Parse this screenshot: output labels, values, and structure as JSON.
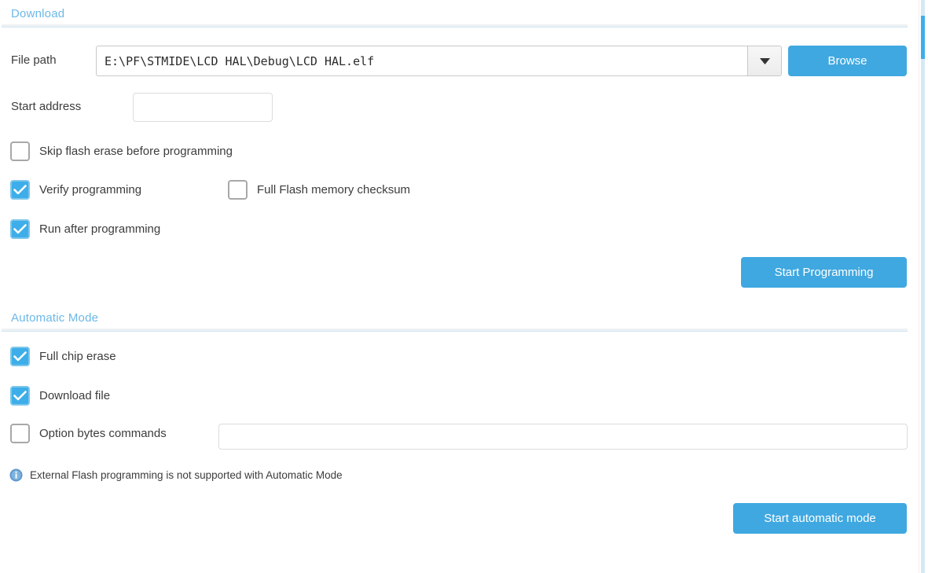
{
  "download_section": {
    "title": "Download",
    "file_path": {
      "label": "File path",
      "value": "E:\\PF\\STMIDE\\LCD HAL\\Debug\\LCD HAL.elf",
      "placeholder": ""
    },
    "browse_button": "Browse",
    "start_address": {
      "label": "Start address",
      "value": "",
      "placeholder": ""
    },
    "checkboxes": [
      {
        "label": "Skip flash erase before programming",
        "checked": false
      },
      {
        "label": "Verify programming",
        "checked": true
      },
      {
        "label": "Full Flash memory checksum",
        "checked": false
      },
      {
        "label": "Run after programming",
        "checked": true
      }
    ],
    "start_programming_button": "Start Programming"
  },
  "automatic_mode_section": {
    "title": "Automatic Mode",
    "checkboxes": [
      {
        "label": "Full chip erase",
        "checked": true
      },
      {
        "label": "Download file",
        "checked": true
      },
      {
        "label": "Option bytes commands",
        "checked": false
      }
    ],
    "option_bytes_input": {
      "value": "",
      "placeholder": ""
    },
    "info_note": "External Flash programming is not supported with Automatic Mode",
    "start_automatic_mode_button": "Start automatic mode"
  },
  "colors": {
    "accent_blue": "#3daee9",
    "button_blue": "#40a8e0",
    "header_blue": "#6cb8e8",
    "text": "#3c3c3c",
    "border": "#dcdcdc"
  }
}
